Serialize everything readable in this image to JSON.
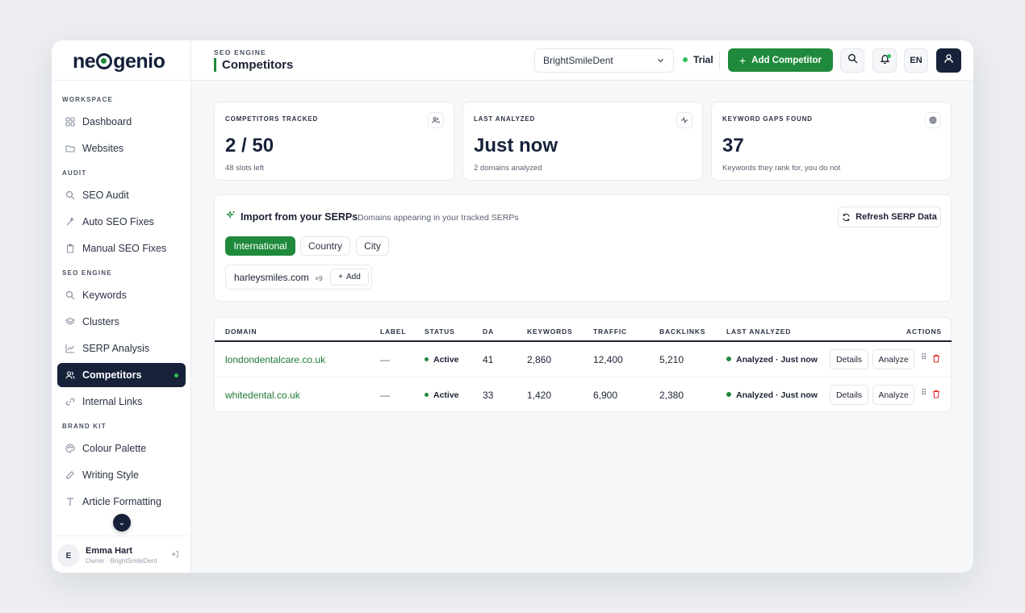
{
  "brand": {
    "logo_pre": "ne",
    "logo_post": "genio",
    "accent": "#1f8a3c",
    "navy": "#17223a"
  },
  "sidebar": {
    "sections": [
      {
        "label": "WORKSPACE",
        "items": [
          {
            "label": "Dashboard",
            "icon": "grid-icon"
          },
          {
            "label": "Websites",
            "icon": "folder-icon"
          }
        ]
      },
      {
        "label": "AUDIT",
        "items": [
          {
            "label": "SEO Audit",
            "icon": "search-icon"
          },
          {
            "label": "Auto SEO Fixes",
            "icon": "wand-icon"
          },
          {
            "label": "Manual SEO Fixes",
            "icon": "clipboard-icon"
          }
        ]
      },
      {
        "label": "SEO ENGINE",
        "items": [
          {
            "label": "Keywords",
            "icon": "search-icon"
          },
          {
            "label": "Clusters",
            "icon": "layers-icon"
          },
          {
            "label": "SERP Analysis",
            "icon": "chart-line-icon"
          },
          {
            "label": "Competitors",
            "icon": "users-icon",
            "active": true
          },
          {
            "label": "Internal Links",
            "icon": "link-icon"
          }
        ]
      },
      {
        "label": "BRAND KIT",
        "items": [
          {
            "label": "Colour Palette",
            "icon": "palette-icon"
          },
          {
            "label": "Writing Style",
            "icon": "pen-icon"
          },
          {
            "label": "Article Formatting",
            "icon": "type-icon"
          }
        ]
      }
    ],
    "user": {
      "initial": "E",
      "name": "Emma Hart",
      "role": "Owner · BrightSmileDent"
    }
  },
  "header": {
    "section": "SEO ENGINE",
    "title": "Competitors",
    "site": "BrightSmileDent",
    "plan": "Trial",
    "add_label": "Add Competitor",
    "lang": "EN"
  },
  "stats": [
    {
      "label": "COMPETITORS TRACKED",
      "value": "2 / 50",
      "sub": "48 slots left",
      "icon": "users-icon"
    },
    {
      "label": "LAST ANALYZED",
      "value": "Just now",
      "sub": "2 domains analyzed",
      "icon": "activity-icon"
    },
    {
      "label": "KEYWORD GAPS FOUND",
      "value": "37",
      "sub": "Keywords they rank for, you do not",
      "icon": "target-icon"
    }
  ],
  "serp": {
    "title": "Import from your SERPs",
    "description": "Domains appearing in your tracked SERPs",
    "refresh_label": "Refresh SERP Data",
    "tabs": [
      "International",
      "Country",
      "City"
    ],
    "active_tab": "International",
    "suggestions": [
      {
        "domain": "harleysmiles.com",
        "count": "×9",
        "add_label": "Add"
      }
    ]
  },
  "table": {
    "columns": [
      "DOMAIN",
      "LABEL",
      "STATUS",
      "DA",
      "KEYWORDS",
      "TRAFFIC",
      "BACKLINKS",
      "LAST ANALYZED",
      "ACTIONS"
    ],
    "rows": [
      {
        "domain": "londondentalcare.co.uk",
        "label": "—",
        "status": "Active",
        "da": "41",
        "keywords": "2,860",
        "traffic": "12,400",
        "backlinks": "5,210",
        "last_analyzed": "Analyzed · Just now"
      },
      {
        "domain": "whitedental.co.uk",
        "label": "—",
        "status": "Active",
        "da": "33",
        "keywords": "1,420",
        "traffic": "6,900",
        "backlinks": "2,380",
        "last_analyzed": "Analyzed · Just now"
      }
    ],
    "details_label": "Details",
    "analyze_label": "Analyze"
  }
}
